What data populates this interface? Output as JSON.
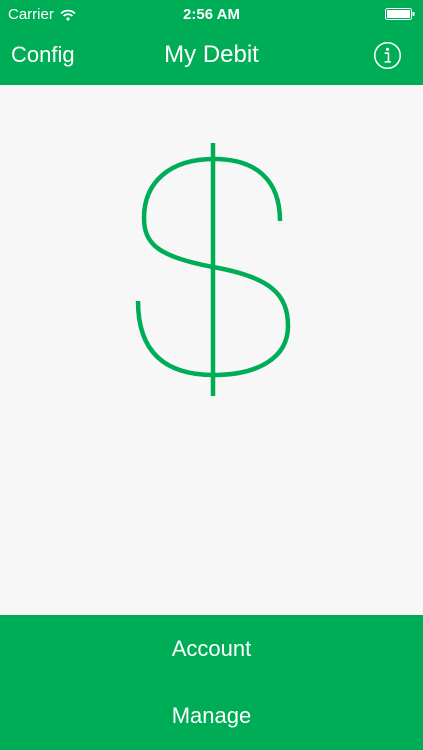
{
  "status_bar": {
    "carrier": "Carrier",
    "time": "2:56 AM"
  },
  "nav": {
    "left_label": "Config",
    "title": "My Debit",
    "right_icon": "info-icon"
  },
  "main": {
    "icon": "dollar-icon"
  },
  "bottom": {
    "buttons": [
      {
        "label": "Account"
      },
      {
        "label": "Manage"
      }
    ]
  },
  "colors": {
    "accent": "#00ad57",
    "background": "#f7f7f7",
    "text_on_accent": "#ffffff"
  }
}
